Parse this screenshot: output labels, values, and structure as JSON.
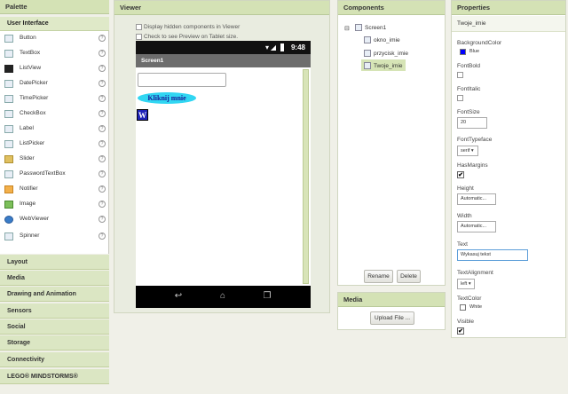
{
  "palette": {
    "title": "Palette",
    "section": "User Interface",
    "items": [
      {
        "label": "Button",
        "icon": "button-icon"
      },
      {
        "label": "TextBox",
        "icon": "textbox-icon"
      },
      {
        "label": "ListView",
        "icon": "listview-icon"
      },
      {
        "label": "DatePicker",
        "icon": "datepicker-icon"
      },
      {
        "label": "TimePicker",
        "icon": "timepicker-icon"
      },
      {
        "label": "CheckBox",
        "icon": "checkbox-icon"
      },
      {
        "label": "Label",
        "icon": "label-icon"
      },
      {
        "label": "ListPicker",
        "icon": "listpicker-icon"
      },
      {
        "label": "Slider",
        "icon": "slider-icon"
      },
      {
        "label": "PasswordTextBox",
        "icon": "password-icon"
      },
      {
        "label": "Notifier",
        "icon": "notifier-icon"
      },
      {
        "label": "Image",
        "icon": "image-icon"
      },
      {
        "label": "WebViewer",
        "icon": "webviewer-icon"
      },
      {
        "label": "Spinner",
        "icon": "spinner-icon"
      }
    ],
    "help_symbol": "?",
    "categories": [
      "Layout",
      "Media",
      "Drawing and Animation",
      "Sensors",
      "Social",
      "Storage",
      "Connectivity",
      "LEGO® MINDSTORMS®"
    ]
  },
  "viewer": {
    "title": "Viewer",
    "option1": "Display hidden components in Viewer",
    "option2": "Check to see Preview on Tablet size.",
    "time": "9:48",
    "screen_title": "Screen1",
    "button_text": "Kliknij mnie",
    "label_text": "W"
  },
  "components": {
    "title": "Components",
    "root": "Screen1",
    "children": [
      "okno_imie",
      "przycisk_imie",
      "Twoje_imie"
    ],
    "rename": "Rename",
    "delete": "Delete"
  },
  "media": {
    "title": "Media",
    "upload": "Upload File ..."
  },
  "properties": {
    "title": "Properties",
    "component": "Twoje_imie",
    "background_color_label": "BackgroundColor",
    "background_color_value": "Blue",
    "background_color_hex": "#0000ff",
    "font_bold_label": "FontBold",
    "font_italic_label": "FontItalic",
    "font_size_label": "FontSize",
    "font_size_value": "20",
    "font_typeface_label": "FontTypeface",
    "font_typeface_value": "serif ▾",
    "has_margins_label": "HasMargins",
    "height_label": "Height",
    "height_value": "Automatic...",
    "width_label": "Width",
    "width_value": "Automatic...",
    "text_label": "Text",
    "text_value": "Wykasuj tekst",
    "text_alignment_label": "TextAlignment",
    "text_alignment_value": "left ▾",
    "text_color_label": "TextColor",
    "text_color_value": "White",
    "text_color_hex": "#ffffff",
    "visible_label": "Visible",
    "check_mark": "✔"
  }
}
